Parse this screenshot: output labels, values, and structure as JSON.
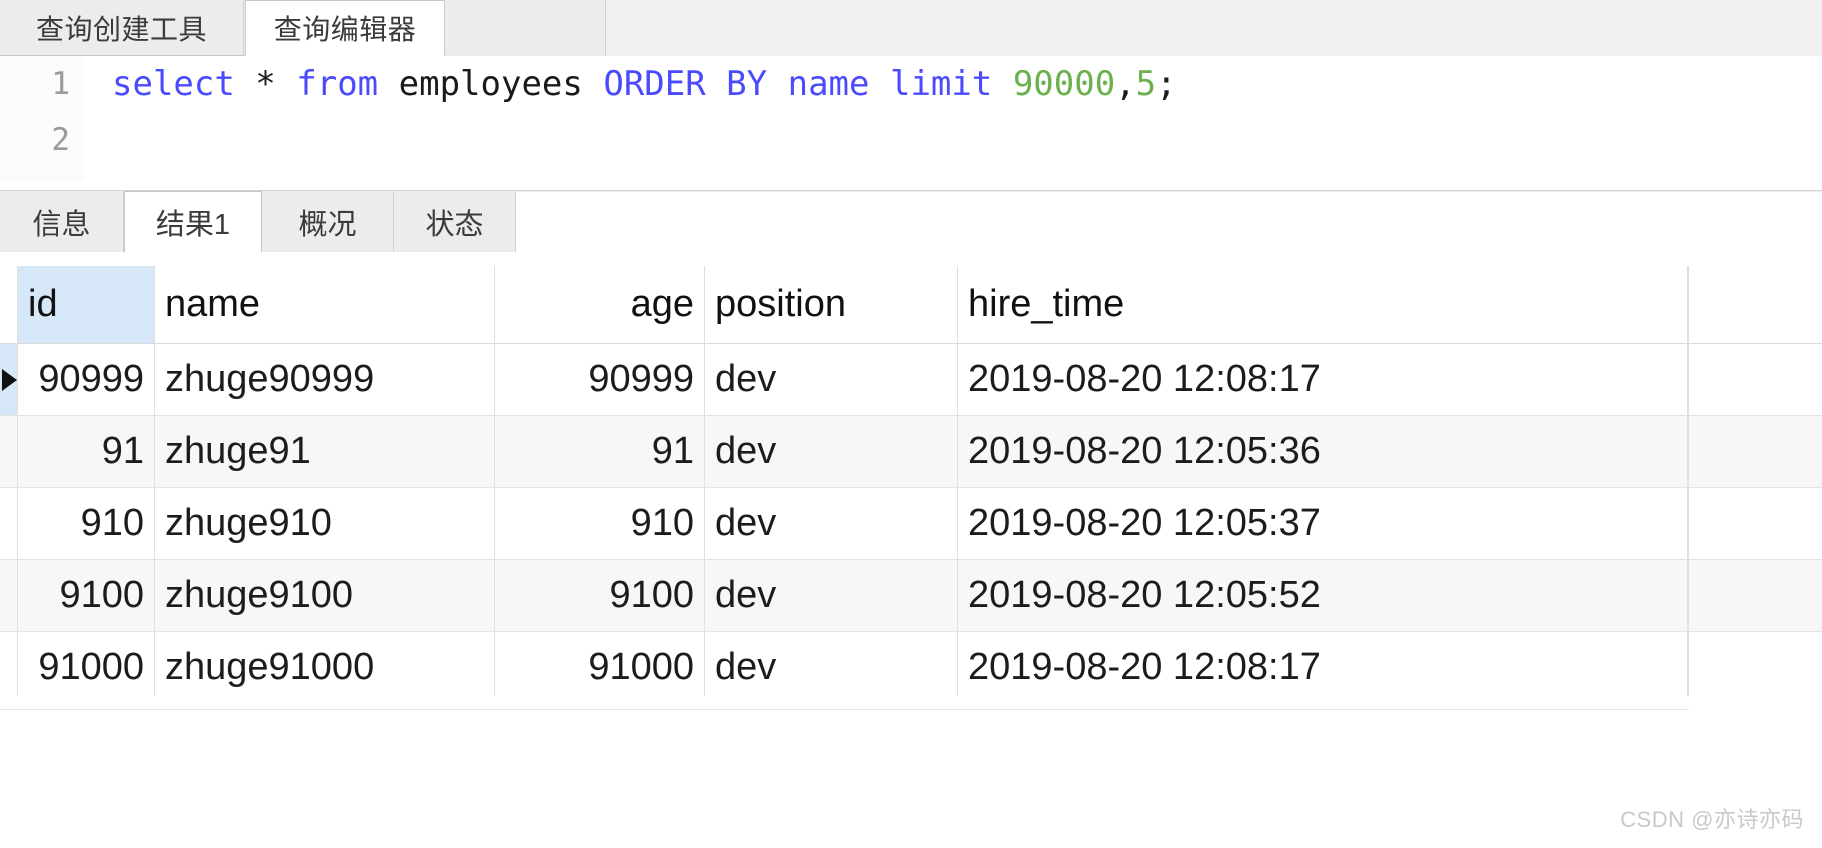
{
  "editor_tabs": [
    {
      "label": "查询创建工具",
      "active": false
    },
    {
      "label": "查询编辑器",
      "active": true
    }
  ],
  "editor": {
    "line_numbers": [
      "1",
      "2"
    ],
    "sql_tokens": [
      {
        "text": "select",
        "type": "keyword"
      },
      {
        "text": " * ",
        "type": "punct"
      },
      {
        "text": "from",
        "type": "keyword"
      },
      {
        "text": " ",
        "type": "punct"
      },
      {
        "text": "employees",
        "type": "identifier"
      },
      {
        "text": " ",
        "type": "punct"
      },
      {
        "text": "ORDER BY",
        "type": "keyword"
      },
      {
        "text": " ",
        "type": "punct"
      },
      {
        "text": "name",
        "type": "keyword"
      },
      {
        "text": " ",
        "type": "punct"
      },
      {
        "text": "limit",
        "type": "keyword"
      },
      {
        "text": " ",
        "type": "punct"
      },
      {
        "text": "90000",
        "type": "number"
      },
      {
        "text": ",",
        "type": "punct"
      },
      {
        "text": "5",
        "type": "number"
      },
      {
        "text": ";",
        "type": "punct"
      }
    ],
    "sql_plain": "select * from employees ORDER BY name limit 90000,5;",
    "line2_text": ""
  },
  "result_tabs": [
    {
      "label": "信息",
      "active": false
    },
    {
      "label": "结果1",
      "active": true
    },
    {
      "label": "概况",
      "active": false
    },
    {
      "label": "状态",
      "active": false
    }
  ],
  "grid": {
    "columns": [
      "id",
      "name",
      "age",
      "position",
      "hire_time"
    ],
    "selected_column": "id",
    "selected_row_index": 0,
    "rows": [
      {
        "id": "90999",
        "name": "zhuge90999",
        "age": "90999",
        "position": "dev",
        "hire_time": "2019-08-20 12:08:17"
      },
      {
        "id": "91",
        "name": "zhuge91",
        "age": "91",
        "position": "dev",
        "hire_time": "2019-08-20 12:05:36"
      },
      {
        "id": "910",
        "name": "zhuge910",
        "age": "910",
        "position": "dev",
        "hire_time": "2019-08-20 12:05:37"
      },
      {
        "id": "9100",
        "name": "zhuge9100",
        "age": "9100",
        "position": "dev",
        "hire_time": "2019-08-20 12:05:52"
      },
      {
        "id": "91000",
        "name": "zhuge91000",
        "age": "91000",
        "position": "dev",
        "hire_time": "2019-08-20 12:08:17"
      }
    ]
  },
  "watermark": {
    "text": "CSDN @亦诗亦码"
  },
  "colors": {
    "keyword": "#4a4aff",
    "number": "#6ab04c",
    "identifier": "#1a1a1a",
    "selection_highlight": "#d6e8f7",
    "alt_row": "#f7f7f7"
  }
}
